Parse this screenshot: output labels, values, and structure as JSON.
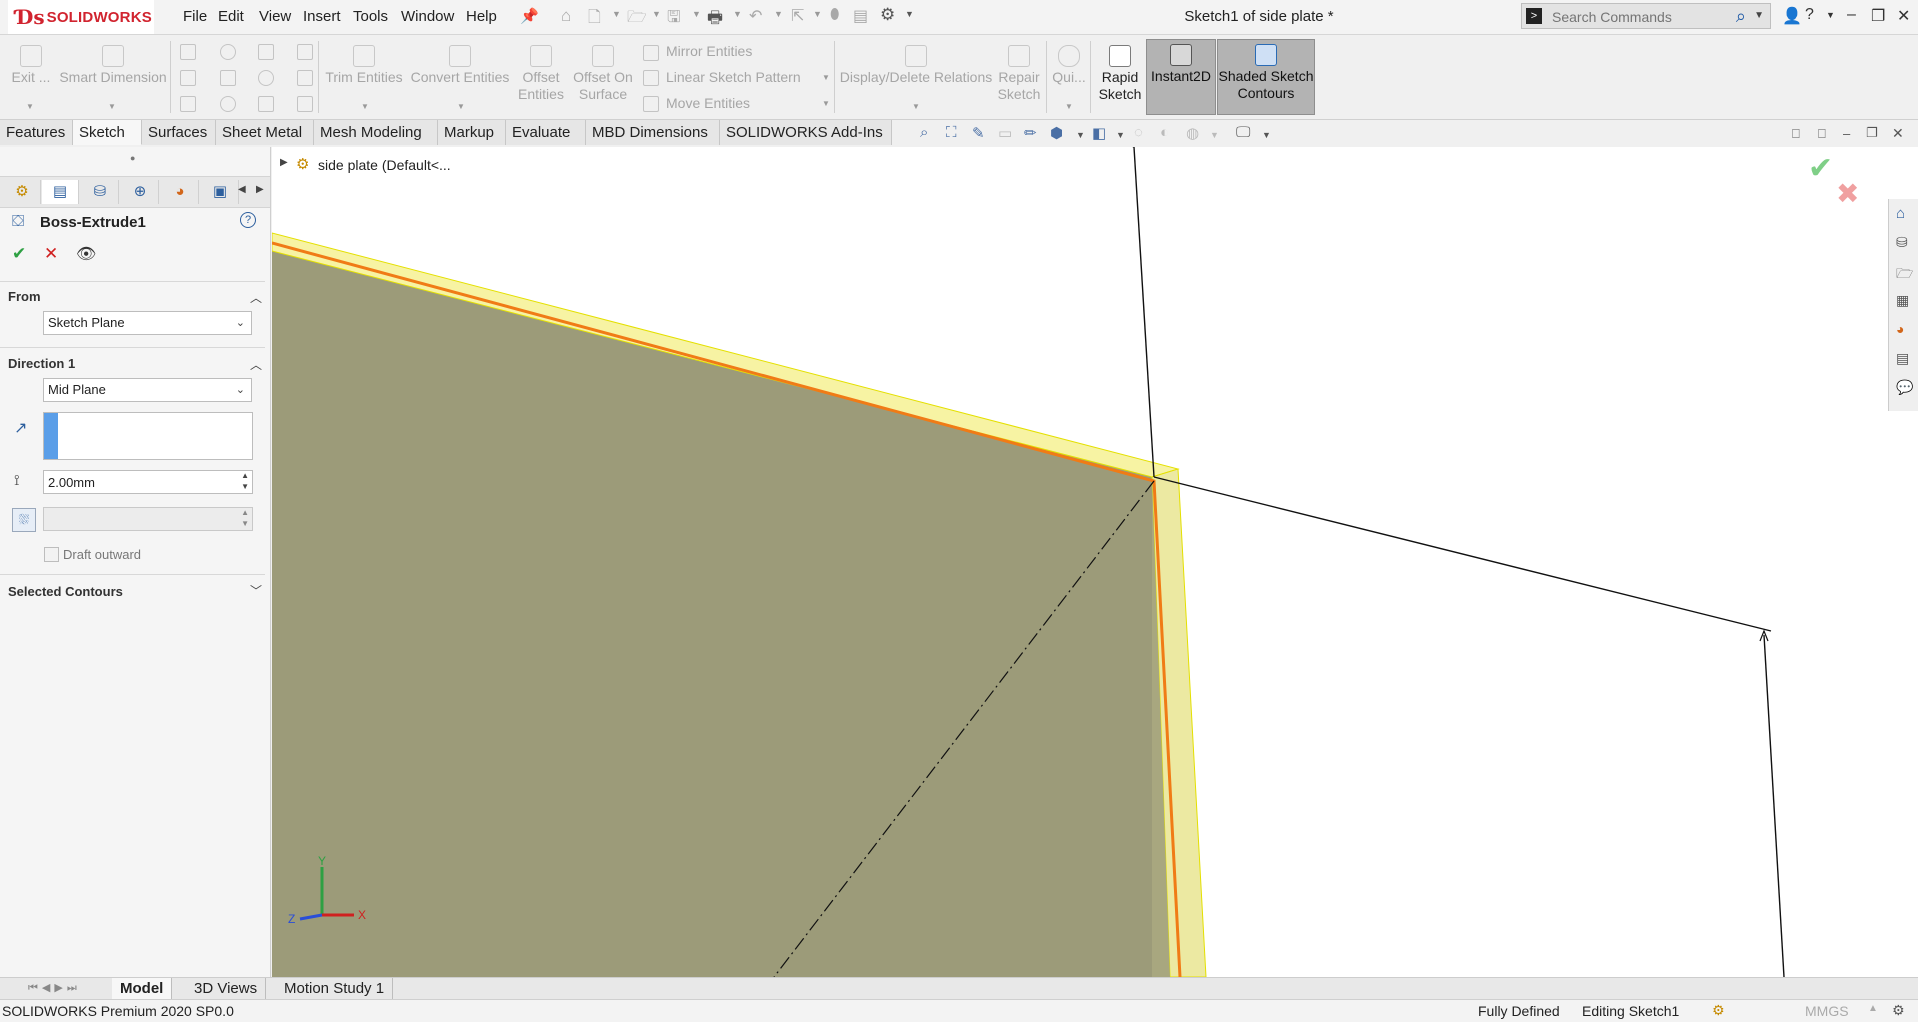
{
  "app": {
    "brand_ds": "Ɗs",
    "brand_name": "SOLIDWORKS",
    "title": "Sketch1 of side plate *"
  },
  "menu": [
    "File",
    "Edit",
    "View",
    "Insert",
    "Tools",
    "Window",
    "Help"
  ],
  "search": {
    "placeholder": "Search Commands"
  },
  "commands": {
    "exit": "Exit ...",
    "smart_dimension": "Smart Dimension",
    "trim_entities": "Trim Entities",
    "convert_entities": "Convert Entities",
    "offset_entities_1": "Offset",
    "offset_entities_2": "Entities",
    "offset_on_surface_1": "Offset On",
    "offset_on_surface_2": "Surface",
    "mirror_entities": "Mirror Entities",
    "linear_sketch_pattern": "Linear Sketch Pattern",
    "move_entities": "Move Entities",
    "display_delete_relations": "Display/Delete Relations",
    "repair_sketch_1": "Repair",
    "repair_sketch_2": "Sketch",
    "quick_snaps": "Qui...",
    "rapid_sketch_1": "Rapid",
    "rapid_sketch_2": "Sketch",
    "instant2d": "Instant2D",
    "shaded_contours_1": "Shaded Sketch",
    "shaded_contours_2": "Contours"
  },
  "tabs": [
    "Features",
    "Sketch",
    "Surfaces",
    "Sheet Metal",
    "Mesh Modeling",
    "Markup",
    "Evaluate",
    "MBD Dimensions",
    "SOLIDWORKS Add-Ins"
  ],
  "active_tab": "Sketch",
  "tree": {
    "part_label": "side plate  (Default<..."
  },
  "property_manager": {
    "feature_name": "Boss-Extrude1",
    "from": {
      "header": "From",
      "value": "Sketch Plane"
    },
    "direction1": {
      "header": "Direction 1",
      "end_condition": "Mid Plane",
      "depth": "2.00mm"
    },
    "draft_outward": "Draft outward",
    "selected_contours": "Selected Contours"
  },
  "axes": {
    "x": "X",
    "y": "Y",
    "z": "Z"
  },
  "bottom_tabs": [
    "Model",
    "3D Views",
    "Motion Study 1"
  ],
  "status": {
    "product": "SOLIDWORKS Premium 2020 SP0.0",
    "defined": "Fully Defined",
    "editing": "Editing Sketch1",
    "units": "MMGS"
  },
  "colors": {
    "plate_face": "#9c9b79",
    "plate_edge": "#f7f3a3",
    "highlight": "#f07b16",
    "accept": "#2ea043",
    "cancel": "#d02020"
  }
}
